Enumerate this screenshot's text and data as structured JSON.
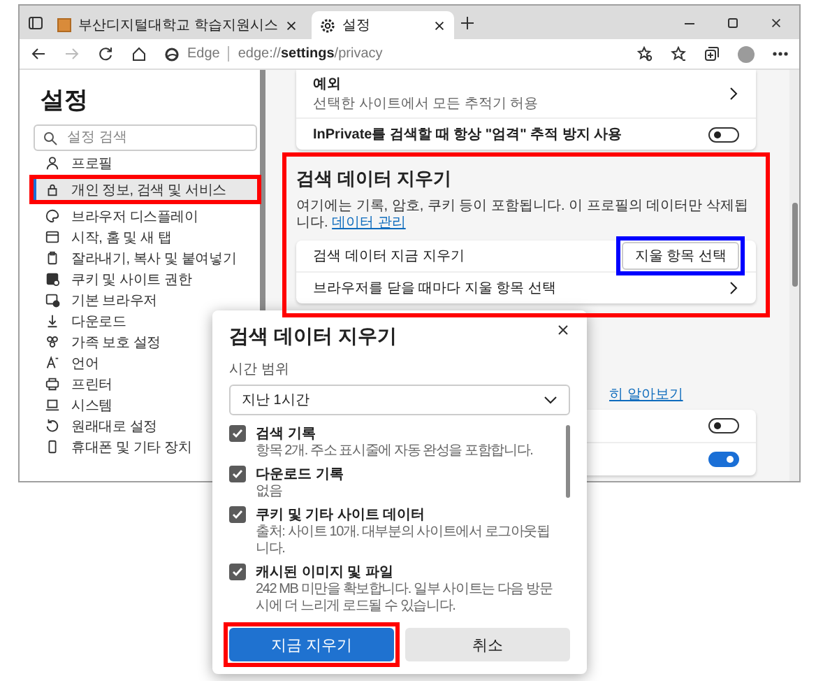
{
  "tabs": [
    {
      "title": "부산디지털대학교 학습지원시스",
      "selected": false
    },
    {
      "title": "설정",
      "selected": true
    }
  ],
  "address_bar": {
    "site": "Edge",
    "url": "edge://**settings**/privacy"
  },
  "sidebar": {
    "title": "설정",
    "search_placeholder": "설정 검색",
    "items": [
      {
        "label": "프로필",
        "selected": false
      },
      {
        "label": "개인 정보, 검색 및 서비스",
        "selected": true
      },
      {
        "label": "브라우저 디스플레이",
        "selected": false
      },
      {
        "label": "시작, 홈 및 새 탭",
        "selected": false
      },
      {
        "label": "잘라내기, 복사 및 붙여넣기",
        "selected": false
      },
      {
        "label": "쿠키 및 사이트 권한",
        "selected": false
      },
      {
        "label": "기본 브라우저",
        "selected": false
      },
      {
        "label": "다운로드",
        "selected": false
      },
      {
        "label": "가족 보호 설정",
        "selected": false
      },
      {
        "label": "언어",
        "selected": false
      },
      {
        "label": "프린터",
        "selected": false
      },
      {
        "label": "시스템",
        "selected": false
      },
      {
        "label": "원래대로 설정",
        "selected": false
      },
      {
        "label": "휴대폰 및 기타 장치",
        "selected": false
      }
    ]
  },
  "privacy_card": {
    "exceptions_title": "예외",
    "exceptions_subtitle": "선택한 사이트에서 모든 추적기 허용",
    "inprivate_label": "InPrivate를 검색할 때 항상 \"엄격\" 추적 방지 사용",
    "inprivate_on": false
  },
  "clear_section": {
    "title": "검색 데이터 지우기",
    "description": "여기에는 기록, 암호, 쿠키 등이 포함됩니다. 이 프로필의 데이터만 삭제됩니다.",
    "link": "데이터 관리",
    "rows": [
      {
        "kind": "button",
        "label": "검색 데이터 지금 지우기",
        "button": "지울 항목 선택"
      },
      {
        "kind": "chevron",
        "label": "브라우저를 닫을 때마다 지울 항목 선택"
      }
    ]
  },
  "next_section": {
    "link": "히 알아보기",
    "toggles": [
      {
        "on": false
      },
      {
        "on": true
      }
    ]
  },
  "dialog": {
    "title": "검색 데이터 지우기",
    "range_label": "시간 범위",
    "range_value": "지난 1시간",
    "options": [
      {
        "label": "검색 기록",
        "detail": "항목 2개. 주소 표시줄에 자동 완성을 포함합니다.",
        "checked": true
      },
      {
        "label": "다운로드 기록",
        "detail": "없음",
        "checked": true
      },
      {
        "label": "쿠키 및 기타 사이트 데이터",
        "detail": "출처: 사이트 10개. 대부분의 사이트에서 로그아웃됩니다.",
        "checked": true
      },
      {
        "label": "캐시된 이미지 및 파일",
        "detail": "242 MB 미만을 확보합니다. 일부 사이트는 다음 방문 시에 더 느리게 로드될 수 있습니다.",
        "checked": true
      }
    ],
    "primary_button": "지금 지우기",
    "secondary_button": "취소"
  },
  "highlights": [
    {
      "color": "#ff0000"
    },
    {
      "color": "#ff0000"
    },
    {
      "color": "#0000ff"
    },
    {
      "color": "#ff0000"
    }
  ]
}
